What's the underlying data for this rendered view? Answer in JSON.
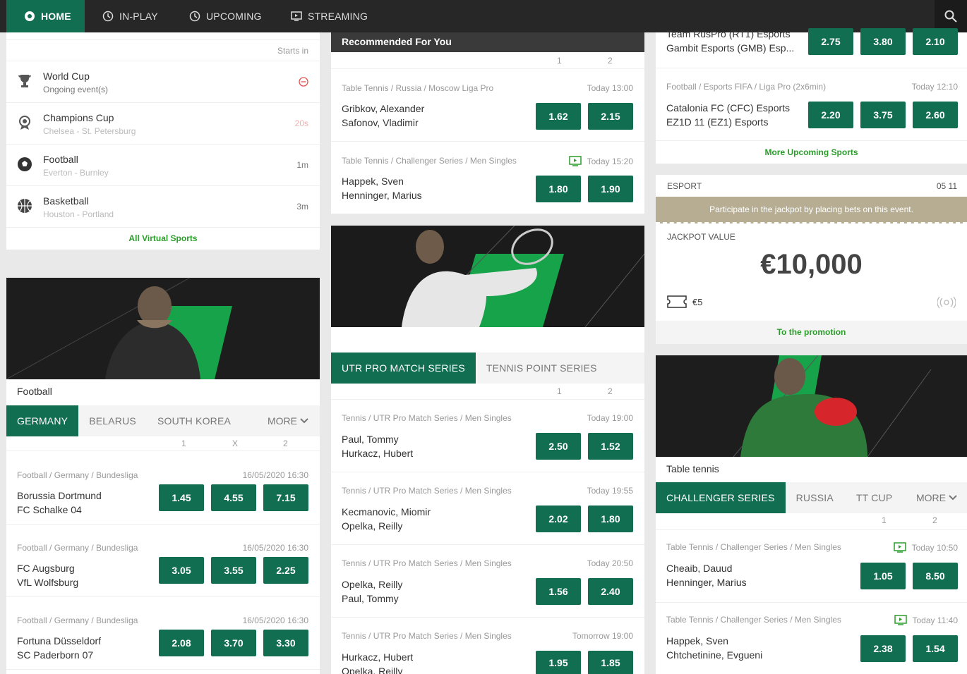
{
  "nav": {
    "home": "HOME",
    "inplay": "IN-PLAY",
    "upcoming": "UPCOMING",
    "streaming": "STREAMING"
  },
  "virtual": {
    "starts_in": "Starts in",
    "rows": [
      {
        "name": "World Cup",
        "sub": "Ongoing event(s)",
        "right": "",
        "icon": "trophy-icon"
      },
      {
        "name": "Champions Cup",
        "sub": "Chelsea - St. Petersburg",
        "right": "20s",
        "icon": "medal-icon"
      },
      {
        "name": "Football",
        "sub": "Everton - Burnley",
        "right": "1m",
        "icon": "football-icon"
      },
      {
        "name": "Basketball",
        "sub": "Houston - Portland",
        "right": "3m",
        "icon": "basketball-icon"
      }
    ],
    "all_link": "All Virtual Sports"
  },
  "football": {
    "title": "Football",
    "tabs": [
      "GERMANY",
      "BELARUS",
      "SOUTH KOREA"
    ],
    "more": "MORE",
    "cols": [
      "1",
      "X",
      "2"
    ],
    "matches": [
      {
        "meta": "Football / Germany / Bundesliga",
        "time": "16/05/2020 16:30",
        "t1": "Borussia Dortmund",
        "t2": "FC Schalke 04",
        "odds": [
          "1.45",
          "4.55",
          "7.15"
        ]
      },
      {
        "meta": "Football / Germany / Bundesliga",
        "time": "16/05/2020 16:30",
        "t1": "FC Augsburg",
        "t2": "VfL Wolfsburg",
        "odds": [
          "3.05",
          "3.55",
          "2.25"
        ]
      },
      {
        "meta": "Football / Germany / Bundesliga",
        "time": "16/05/2020 16:30",
        "t1": "Fortuna Düsseldorf",
        "t2": "SC Paderborn 07",
        "odds": [
          "2.08",
          "3.70",
          "3.30"
        ]
      }
    ]
  },
  "recommended": {
    "title": "Recommended For You",
    "cols": [
      "1",
      "2"
    ],
    "matches": [
      {
        "meta": "Table Tennis / Russia / Moscow Liga Pro",
        "time": "Today 13:00",
        "t1": "Gribkov, Alexander",
        "t2": "Safonov, Vladimir",
        "odds": [
          "1.62",
          "2.15"
        ]
      },
      {
        "meta": "Table Tennis / Challenger Series / Men Singles",
        "time": "Today 15:20",
        "t1": "Happek, Sven",
        "t2": "Henninger, Marius",
        "odds": [
          "1.80",
          "1.90"
        ]
      }
    ]
  },
  "tennis": {
    "tabs": [
      "UTR PRO MATCH SERIES",
      "TENNIS POINT SERIES"
    ],
    "cols": [
      "1",
      "2"
    ],
    "matches": [
      {
        "meta": "Tennis / UTR Pro Match Series / Men Singles",
        "time": "Today 19:00",
        "t1": "Paul, Tommy",
        "t2": "Hurkacz, Hubert",
        "odds": [
          "2.50",
          "1.52"
        ]
      },
      {
        "meta": "Tennis / UTR Pro Match Series / Men Singles",
        "time": "Today 19:55",
        "t1": "Kecmanovic, Miomir",
        "t2": "Opelka, Reilly",
        "odds": [
          "2.02",
          "1.80"
        ]
      },
      {
        "meta": "Tennis / UTR Pro Match Series / Men Singles",
        "time": "Today 20:50",
        "t1": "Opelka, Reilly",
        "t2": "Paul, Tommy",
        "odds": [
          "1.56",
          "2.40"
        ]
      },
      {
        "meta": "Tennis / UTR Pro Match Series / Men Singles",
        "time": "Tomorrow 19:00",
        "t1": "Hurkacz, Hubert",
        "t2": "Opelka, Reilly",
        "odds": [
          "1.95",
          "1.85"
        ]
      }
    ]
  },
  "upcoming": {
    "m1": {
      "t1": "Team RusPro (RT1) Esports",
      "t2": "Gambit Esports (GMB) Esp...",
      "odds": [
        "2.75",
        "3.80",
        "2.10"
      ]
    },
    "m2": {
      "meta": "Football / Esports FIFA / Liga Pro (2x6min)",
      "time": "Today 12:10",
      "t1": "Catalonia FC (CFC) Esports",
      "t2": "EZ1D 11 (EZ1) Esports",
      "odds": [
        "2.20",
        "3.75",
        "2.60"
      ]
    },
    "more_link": "More Upcoming Sports"
  },
  "jackpot": {
    "label": "ESPORT",
    "time": "05 11",
    "banner": "Participate in the jackpot by placing bets on this event.",
    "value_label": "JACKPOT VALUE",
    "value": "€10,000",
    "stake": "€5",
    "link": "To the promotion"
  },
  "tt": {
    "title": "Table tennis",
    "tabs": [
      "CHALLENGER SERIES",
      "RUSSIA",
      "TT CUP"
    ],
    "more": "MORE",
    "cols": [
      "1",
      "2"
    ],
    "matches": [
      {
        "meta": "Table Tennis / Challenger Series / Men Singles",
        "time": "Today 10:50",
        "t1": "Cheaib, Dauud",
        "t2": "Henninger, Marius",
        "odds": [
          "1.05",
          "8.50"
        ]
      },
      {
        "meta": "Table Tennis / Challenger Series / Men Singles",
        "time": "Today 11:40",
        "t1": "Happek, Sven",
        "t2": "Chtchetinine, Evgueni",
        "odds": [
          "2.38",
          "1.54"
        ]
      }
    ]
  },
  "colors": {
    "green": "#126e51",
    "nav": "#272727",
    "link": "#2a9d2a",
    "jackpot_banner": "#b6ad93"
  }
}
